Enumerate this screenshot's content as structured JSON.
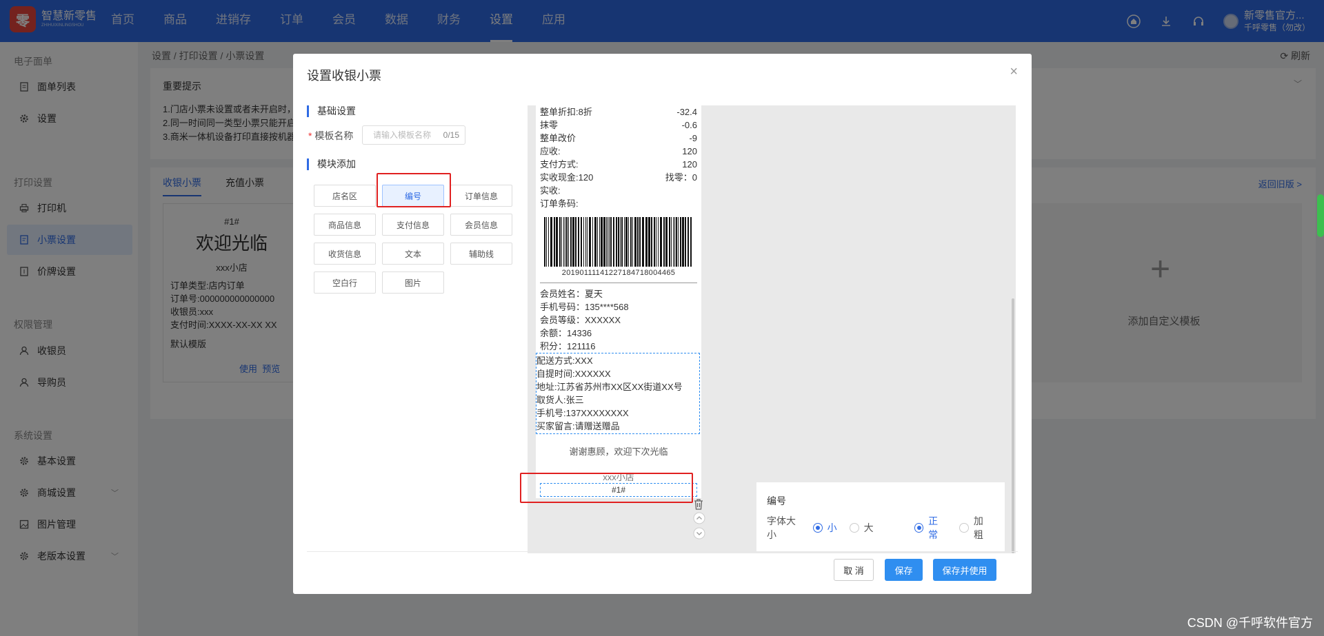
{
  "app": {
    "logo_mark": "零",
    "logo_name": "智慧新零售",
    "logo_sub": "ZHIHUIXINLINGSHOU"
  },
  "nav": {
    "items": [
      {
        "label": "首页"
      },
      {
        "label": "商品"
      },
      {
        "label": "进销存"
      },
      {
        "label": "订单"
      },
      {
        "label": "会员"
      },
      {
        "label": "数据"
      },
      {
        "label": "财务"
      },
      {
        "label": "设置"
      },
      {
        "label": "应用"
      }
    ],
    "active": "设置"
  },
  "user": {
    "name": "新零售官方...",
    "sub": "千呼零售（勿改）"
  },
  "sidebar": {
    "sections": [
      {
        "title": "电子面单",
        "items": [
          {
            "label": "面单列表",
            "icon": "document-icon"
          },
          {
            "label": "设置",
            "icon": "gear-icon"
          }
        ]
      },
      {
        "title": "打印设置",
        "items": [
          {
            "label": "打印机",
            "icon": "printer-icon"
          },
          {
            "label": "小票设置",
            "icon": "receipt-icon",
            "active": true
          },
          {
            "label": "价牌设置",
            "icon": "price-tag-icon"
          }
        ]
      },
      {
        "title": "权限管理",
        "items": [
          {
            "label": "收银员",
            "icon": "user-icon"
          },
          {
            "label": "导购员",
            "icon": "user-icon"
          }
        ]
      },
      {
        "title": "系统设置",
        "items": [
          {
            "label": "基本设置",
            "icon": "gear-icon"
          },
          {
            "label": "商城设置",
            "icon": "gear-icon",
            "caret": "﹀"
          },
          {
            "label": "图片管理",
            "icon": "image-icon"
          },
          {
            "label": "老版本设置",
            "icon": "gear-icon",
            "caret": "﹀"
          }
        ]
      }
    ]
  },
  "main": {
    "breadcrumb": "设置 / 打印设置 / 小票设置",
    "refresh": "刷新",
    "notice_title": "重要提示",
    "notices": [
      "1.门店小票未设置或者未开启时，",
      "2.同一时间同一类型小票只能开启",
      "3.商米一体机设备打印直接按机器"
    ],
    "tabs": [
      {
        "label": "收银小票"
      },
      {
        "label": "充值小票"
      }
    ],
    "back_link": "返回旧版 >",
    "card": {
      "num": "#1#",
      "welcome": "欢迎光临",
      "store": "xxx小店",
      "lines": [
        "订单类型:店内订单",
        "订单号:000000000000000",
        "收银员:xxx",
        "支付时间:XXXX-XX-XX XX"
      ],
      "name": "默认模版",
      "use": "使用",
      "preview": "预览"
    },
    "add_template": "添加自定义模板"
  },
  "dialog": {
    "title": "设置收银小票",
    "close": "×",
    "basic_title": "基础设置",
    "name_label": "模板名称",
    "name_placeholder": "请输入模板名称",
    "name_count": "0/15",
    "module_title": "模块添加",
    "modules": [
      {
        "label": "店名区"
      },
      {
        "label": "编号",
        "selected": true
      },
      {
        "label": "订单信息"
      },
      {
        "label": "商品信息"
      },
      {
        "label": "支付信息"
      },
      {
        "label": "会员信息"
      },
      {
        "label": "收货信息"
      },
      {
        "label": "文本"
      },
      {
        "label": "辅助线"
      },
      {
        "label": "空白行"
      },
      {
        "label": "图片"
      }
    ],
    "receipt": {
      "rows": [
        [
          "整单折扣:8折",
          "-32.4"
        ],
        [
          "抹零",
          "-0.6"
        ],
        [
          "整单改价",
          "-9"
        ],
        [
          "应收:",
          "120"
        ],
        [
          "支付方式:",
          "120"
        ],
        [
          "实收现金:120",
          "找零：0"
        ],
        [
          "实收:",
          ""
        ],
        [
          "订单条码:",
          ""
        ]
      ],
      "barcode_num": "20190111141227184718004465",
      "member": [
        "会员姓名：夏天",
        "手机号码：135****568",
        "会员等级：XXXXXX",
        "余额：14336",
        "积分：121116"
      ],
      "delivery": [
        "配送方式:XXX",
        "自提时间:XXXXXX",
        "地址:江苏省苏州市XX区XX街道XX号",
        "取货人:张三",
        "手机号:137XXXXXXXX",
        "买家留言:请赠送赠品"
      ],
      "thanks": "谢谢惠顾，欢迎下次光临",
      "store": "xxx小店",
      "number": "#1#"
    },
    "props": {
      "title": "编号",
      "font_size_label": "字体大小",
      "size_small": "小",
      "size_large": "大",
      "weight_normal": "正常",
      "weight_bold": "加粗"
    },
    "buttons": {
      "cancel": "取 消",
      "save": "保存",
      "save_use": "保存并使用"
    }
  },
  "watermark": "CSDN @千呼软件官方",
  "colors": {
    "brand": "#2f6be4",
    "button": "#2f8ef0",
    "highlight": "#e02020"
  }
}
